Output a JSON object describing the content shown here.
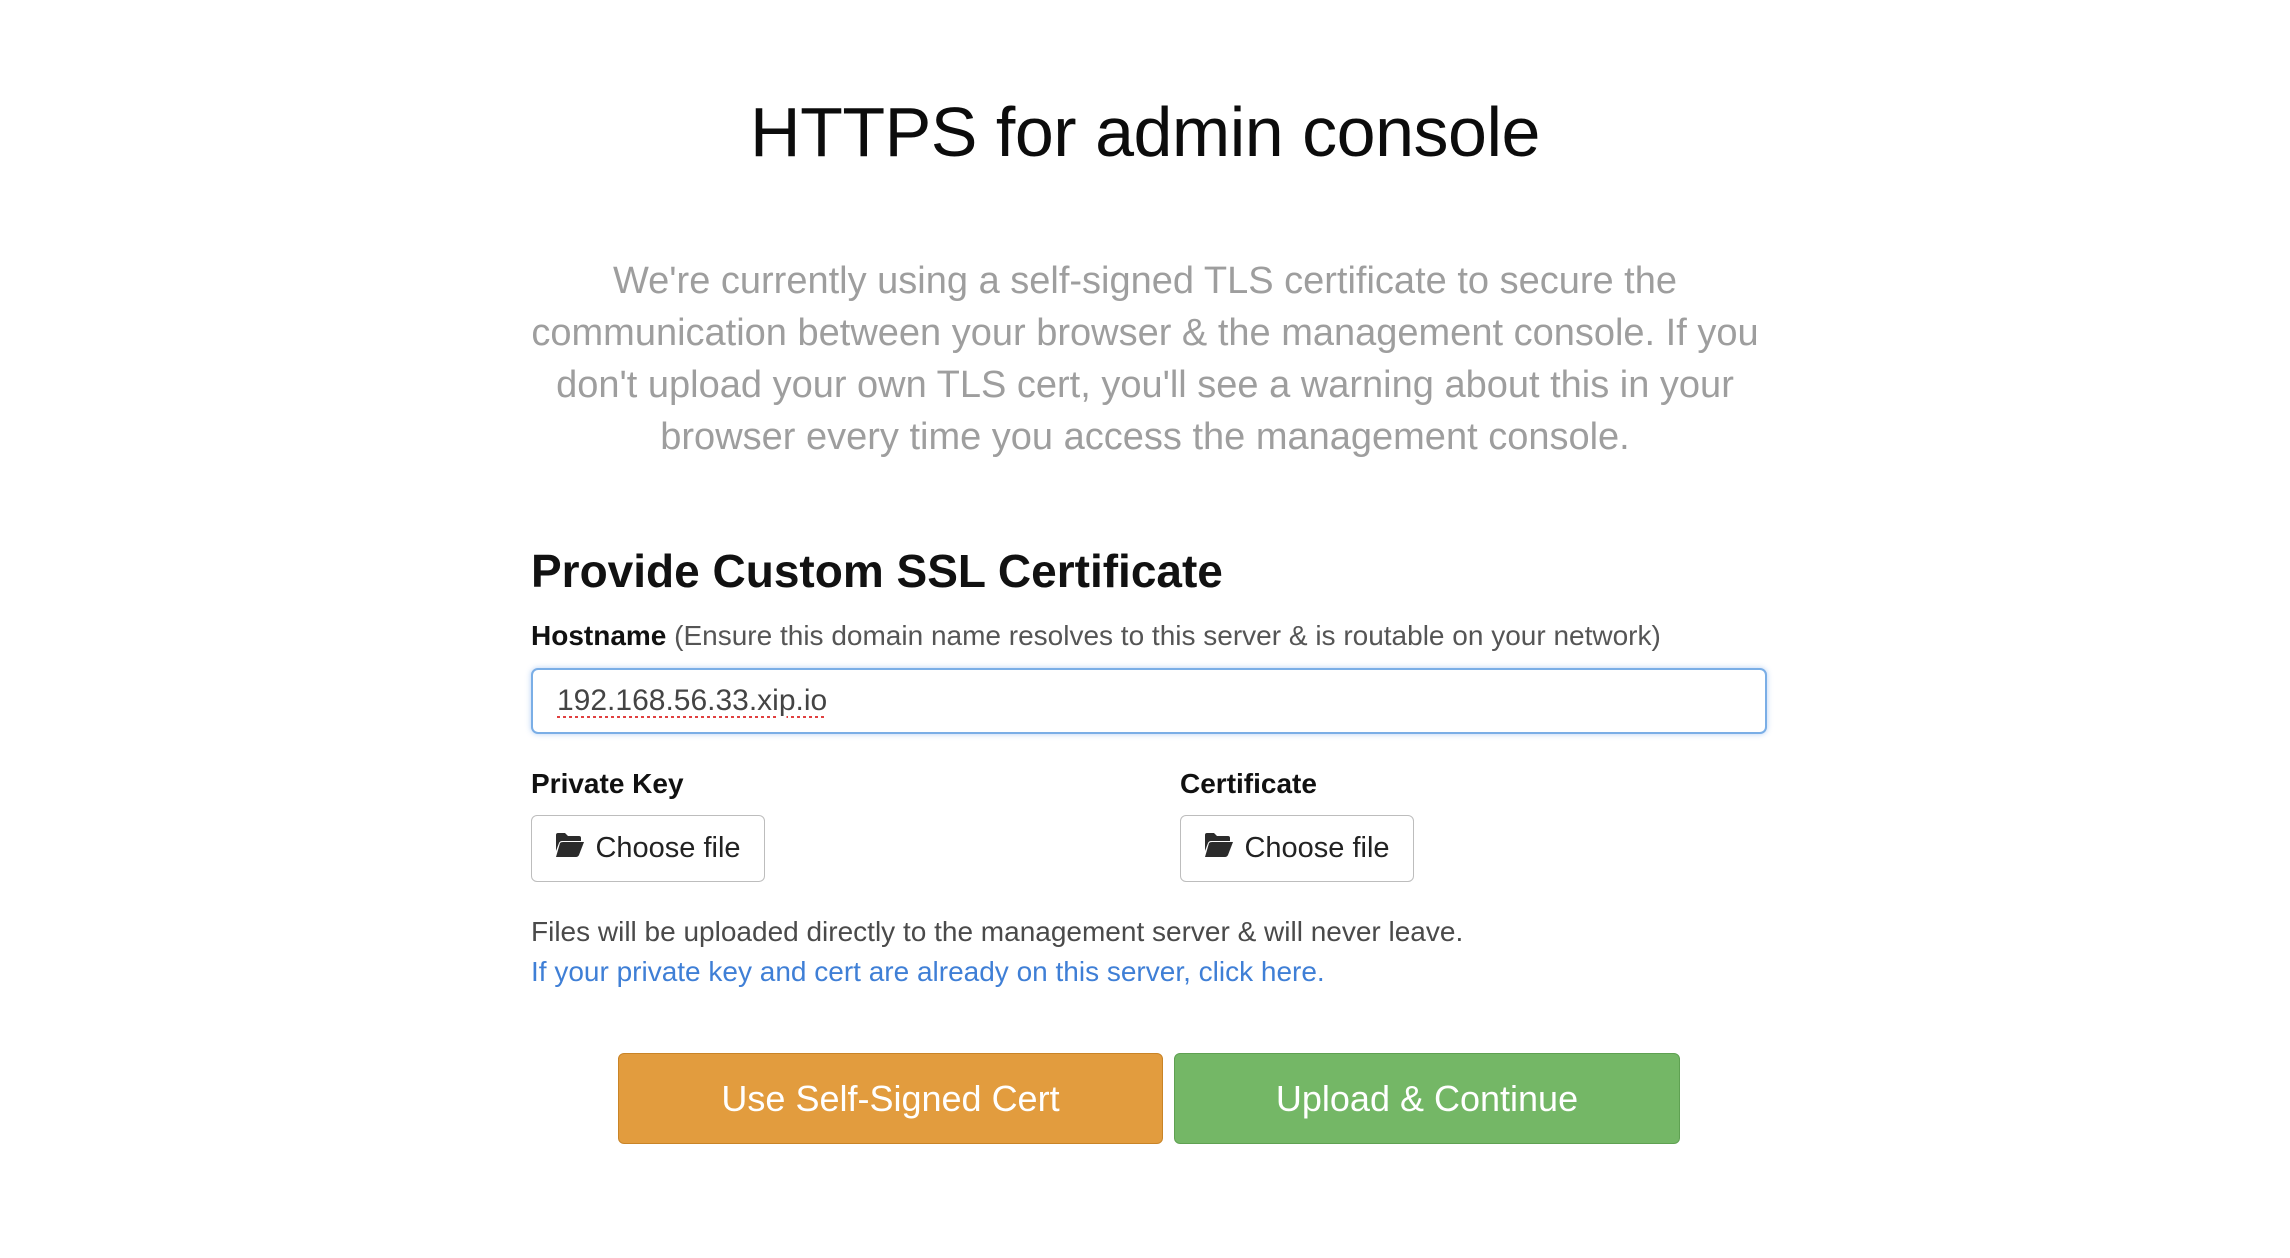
{
  "page": {
    "title": "HTTPS for admin console",
    "intro": "We're currently using a self-signed TLS certificate to secure the communication between your browser & the management console. If you don't upload your own TLS cert, you'll see a warning about this in your browser every time you access the management console."
  },
  "form": {
    "section_title": "Provide Custom SSL Certificate",
    "hostname": {
      "label": "Hostname",
      "hint": "(Ensure this domain name resolves to this server & is routable on your network)",
      "value": "192.168.56.33.xip.io"
    },
    "private_key": {
      "label": "Private Key",
      "button_label": "Choose file",
      "icon": "folder-open-icon"
    },
    "certificate": {
      "label": "Certificate",
      "button_label": "Choose file",
      "icon": "folder-open-icon"
    },
    "files_note": "Files will be uploaded directly to the management server & will never leave.",
    "server_link": "If your private key and cert are already on this server, click here."
  },
  "actions": {
    "self_signed_label": "Use Self-Signed Cert",
    "upload_label": "Upload & Continue"
  },
  "colors": {
    "self_signed_button": "#e29c3e",
    "upload_button": "#74b766",
    "link": "#3f7fd6",
    "input_focus_border": "#7aaee6"
  }
}
